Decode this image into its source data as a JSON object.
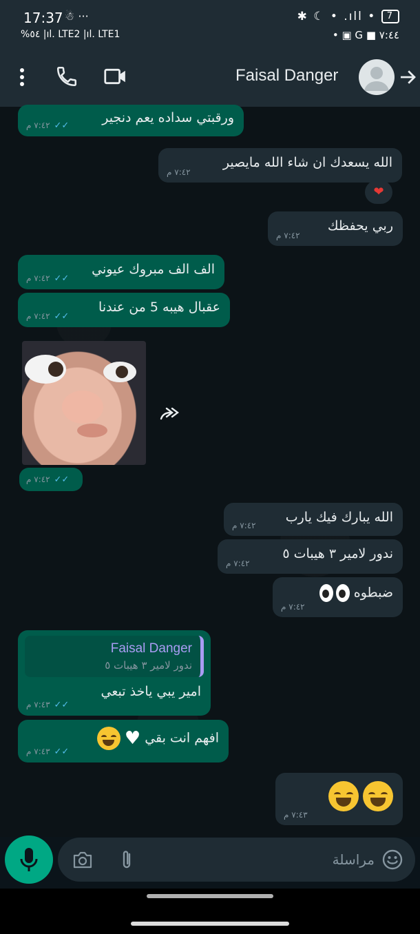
{
  "status_bar": {
    "time": "17:37",
    "left_extra": "☃ ···",
    "left_line2": "%٥٤ |ıl. LTE2 |ıl. LTE1",
    "right_line1": "✱ ☾ • .ıll •",
    "battery": "7",
    "right_line2": "• ▣ G ■ ٧:٤٤"
  },
  "header": {
    "contact_name": "Faisal Danger",
    "icons": [
      "more-vert-icon",
      "phone-icon",
      "video-call-icon",
      "avatar",
      "back-arrow-icon"
    ]
  },
  "messages": [
    {
      "dir": "out",
      "text": "ورقبتي سداده يعم دنجير",
      "time": "٧:٤٢ م",
      "ticks": "✓✓"
    },
    {
      "dir": "in",
      "text": "الله يسعدك ان شاء الله مايصير",
      "time": "٧:٤٢ م",
      "reaction": "❤"
    },
    {
      "dir": "in",
      "text": "ربي يحفظك",
      "time": "٧:٤٢ م"
    },
    {
      "dir": "out",
      "text": "الف الف مبروك عيوني",
      "time": "٧:٤٢ م",
      "ticks": "✓✓"
    },
    {
      "dir": "out",
      "text": "عقبال هيبه 5 من عندنا",
      "time": "٧:٤٢ م",
      "ticks": "✓✓"
    },
    {
      "dir": "out",
      "type": "image",
      "time": "٧:٤٢ م",
      "ticks": "✓✓"
    },
    {
      "dir": "in",
      "text": "الله يبارك فيك يارب",
      "time": "٧:٤٢ م"
    },
    {
      "dir": "in",
      "text": "ندور لامير ٣ هيبات ٥",
      "time": "٧:٤٢ م"
    },
    {
      "dir": "in",
      "text": "ضبطوه",
      "time": "٧:٤٢ م",
      "emoji": "eyes"
    },
    {
      "dir": "out",
      "quote_name": "Faisal Danger",
      "quote_text": "ندور لامير ٣ هيبات ٥",
      "text": "امير يبي ياخذ تبعي",
      "time": "٧:٤٣ م",
      "ticks": "✓✓"
    },
    {
      "dir": "out",
      "text": "افهم انت بقي",
      "time": "٧:٤٣ م",
      "ticks": "✓✓",
      "emoji": "white-heart + laughing"
    },
    {
      "dir": "in",
      "text": "",
      "time": "٧:٤٣ م",
      "emoji": "laughing x2"
    }
  ],
  "composer": {
    "placeholder": "مراسلة",
    "value": ""
  },
  "colors": {
    "bg": "#0b141a",
    "out_bubble": "#005c4b",
    "in_bubble": "#1f2c34",
    "accent": "#00a884",
    "read_ticks": "#53bdeb"
  }
}
